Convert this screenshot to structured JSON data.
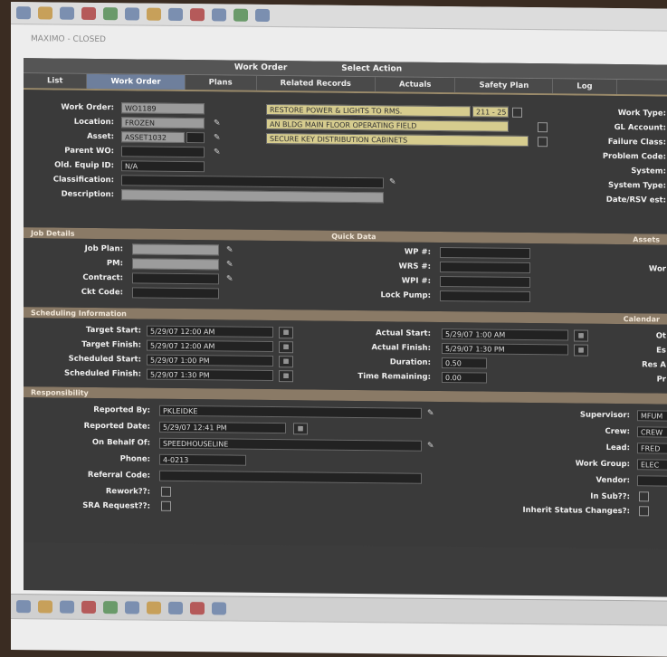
{
  "window": {
    "title": "MAXIMO - CLOSED"
  },
  "menubar": {
    "left": "Work Order",
    "center": "Select Action",
    "right": ""
  },
  "tabs": [
    "List",
    "Work Order",
    "Plans",
    "Related Records",
    "Actuals",
    "Safety Plan",
    "Log"
  ],
  "work_order": {
    "labels": {
      "work_order": "Work Order:",
      "location": "Location:",
      "asset": "Asset:",
      "parent_wo": "Parent WO:",
      "equip_id": "Old. Equip ID:",
      "classification": "Classification:",
      "description": "Description:"
    },
    "values": {
      "work_order": "WO1189",
      "location": "FROZEN",
      "asset": "ASSET1032",
      "equip_id": "N/A"
    },
    "desc_line1": "RESTORE POWER & LIGHTS TO RMS.",
    "desc_line1_extra": "211 - 25",
    "desc_line2": "AN BLDG MAIN FLOOR OPERATING FIELD",
    "desc_line3": "SECURE KEY DISTRIBUTION CABINETS"
  },
  "right_labels": [
    "Work Type:",
    "GL Account:",
    "Failure Class:",
    "Problem Code:",
    "System:",
    "System Type:",
    "Date/RSV est:"
  ],
  "job_details": {
    "header_left": "Job Details",
    "header_mid": "Quick Data",
    "header_right": "Assets",
    "labels": [
      "Job Plan:",
      "PM:",
      "Contract:",
      "Ckt Code:"
    ],
    "labels_mid": [
      "WP #:",
      "WRS #:",
      "WPI #:",
      "Lock Pump:"
    ],
    "right_label": "Wor"
  },
  "scheduling": {
    "header_left": "Scheduling Information",
    "header_right": "Calendar",
    "labels": [
      "Target Start:",
      "Target Finish:",
      "Scheduled Start:",
      "Scheduled Finish:"
    ],
    "values": [
      "5/29/07 12:00 AM",
      "5/29/07 12:00 AM",
      "5/29/07 1:00 PM",
      "5/29/07 1:30 PM"
    ],
    "labels_mid": [
      "Actual Start:",
      "Actual Finish:",
      "Duration:",
      "Time Remaining:"
    ],
    "values_mid": [
      "5/29/07 1:00 AM",
      "5/29/07 1:30 PM",
      "0.50",
      "0.00"
    ],
    "right_labels": [
      "Ot",
      "Es",
      "Res A",
      "Pr"
    ]
  },
  "responsibility": {
    "header_left": "Responsibility",
    "labels": [
      "Reported By:",
      "Reported Date:",
      "On Behalf Of:",
      "Phone:",
      "Referral Code:",
      "Rework??:",
      "SRA Request??:"
    ],
    "values": [
      "PKLEIDKE",
      "5/29/07 12:41 PM",
      "SPEEDHOUSELINE",
      "4-0213",
      "",
      "",
      ""
    ],
    "right_labels": [
      "Supervisor:",
      "Crew:",
      "Lead:",
      "Work Group:",
      "Vendor:",
      "In Sub??:",
      "Inherit Status Changes?:"
    ],
    "right_values": [
      "MFUM",
      "CREW",
      "FRED",
      "ELEC",
      "",
      "",
      ""
    ]
  }
}
